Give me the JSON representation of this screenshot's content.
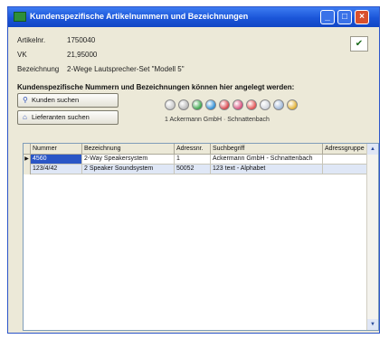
{
  "window": {
    "title": "Kundenspezifische Artikelnummern und Bezeichnungen",
    "minimize_label": "_",
    "maximize_label": "□",
    "close_label": "×"
  },
  "article": {
    "artikel_label": "Artikelnr.",
    "artikel_value": "1750040",
    "vk_label": "VK",
    "vk_value": "21,95000",
    "bezeichnung_label": "Bezeichnung",
    "bezeichnung_value": "2-Wege Lautsprecher-Set \"Modell 5\"",
    "check_label": "✔"
  },
  "hint_text": "Kundenspezifische Nummern und Bezeichnungen können hier angelegt werden:",
  "buttons": {
    "kunden_suchen": "Kunden suchen",
    "lieferanten_suchen": "Lieferanten suchen"
  },
  "status_colors": [
    "#c9c9c9",
    "#b9b9b9",
    "#3aa64a",
    "#2f8fd6",
    "#d9434a",
    "#d94f7c",
    "#e45151",
    "#cfd4dc",
    "#9fb7d8",
    "#e3b233"
  ],
  "customer_line": "1 Ackermann GmbH · Schnattenbach",
  "grid": {
    "headers": [
      "Nummer",
      "Bezeichnung",
      "Adressnr.",
      "Suchbegriff",
      "Adressgruppe"
    ],
    "rows": [
      [
        "4560",
        "2-Way Speakersystem",
        "1",
        "Ackermann GmbH - Schnattenbach",
        ""
      ],
      [
        "123/4/42",
        "2 Speaker Soundsystem",
        "50052",
        "123 text - Alphabet",
        ""
      ]
    ]
  }
}
